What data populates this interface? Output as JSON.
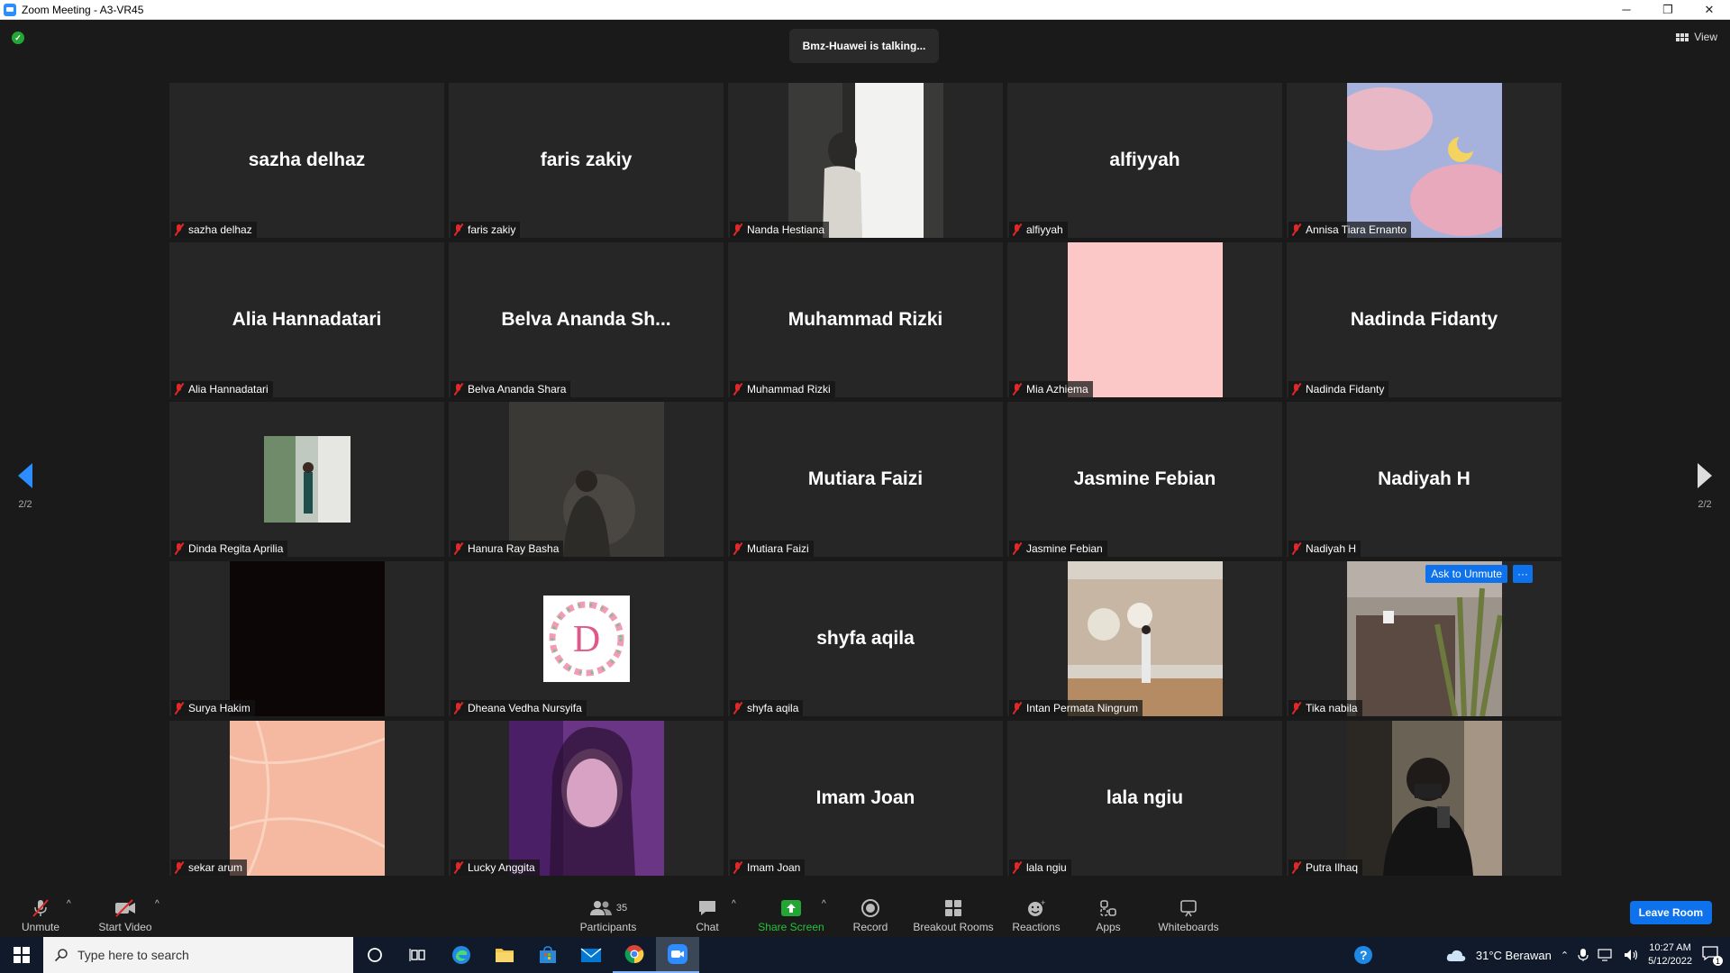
{
  "window": {
    "title": "Zoom Meeting - A3-VR45",
    "minimize": "─",
    "restore": "❐",
    "close": "✕"
  },
  "meeting": {
    "talking": "Bmz-Huawei is talking...",
    "view_label": "View",
    "page_left": "2/2",
    "page_right": "2/2",
    "ask_to_unmute": "Ask to Unmute",
    "more": "···"
  },
  "tiles": [
    {
      "big": "sazha delhaz",
      "label": "sazha delhaz"
    },
    {
      "big": "faris zakiy",
      "label": "faris zakiy"
    },
    {
      "big": "",
      "label": "Nanda Hestiana",
      "media": "window-photo"
    },
    {
      "big": "alfiyyah",
      "label": "alfiyyah"
    },
    {
      "big": "",
      "label": "Annisa Tiara Ernanto",
      "media": "moon-sky"
    },
    {
      "big": "Alia Hannadatari",
      "label": "Alia Hannadatari"
    },
    {
      "big": "Belva Ananda Sh...",
      "label": "Belva Ananda Shara"
    },
    {
      "big": "Muhammad Rizki",
      "label": "Muhammad Rizki"
    },
    {
      "big": "",
      "label": "Mia Azhiema",
      "media": "pink"
    },
    {
      "big": "Nadinda Fidanty",
      "label": "Nadinda Fidanty"
    },
    {
      "big": "",
      "label": "Dinda Regita Aprilia",
      "media": "garden-photo"
    },
    {
      "big": "",
      "label": "Hanura Ray Basha",
      "media": "dark-photo"
    },
    {
      "big": "Mutiara Faizi",
      "label": "Mutiara Faizi"
    },
    {
      "big": "Jasmine Febian",
      "label": "Jasmine Febian"
    },
    {
      "big": "Nadiyah H",
      "label": "Nadiyah H"
    },
    {
      "big": "",
      "label": "Surya Hakim",
      "media": "black"
    },
    {
      "big": "",
      "label": "Dheana Vedha Nursyifa",
      "media": "letter-d"
    },
    {
      "big": "shyfa aqila",
      "label": "shyfa aqila"
    },
    {
      "big": "",
      "label": "Intan Permata Ningrum",
      "media": "museum-photo"
    },
    {
      "big": "",
      "label": "Tika nabila",
      "media": "plant-photo"
    },
    {
      "big": "",
      "label": "sekar arum",
      "media": "peach"
    },
    {
      "big": "",
      "label": "Lucky Anggita",
      "media": "purple-selfie"
    },
    {
      "big": "Imam Joan",
      "label": "Imam Joan"
    },
    {
      "big": "lala ngiu",
      "label": "lala ngiu"
    },
    {
      "big": "",
      "label": "Putra Ilhaq",
      "media": "mirror-selfie"
    }
  ],
  "letter_d": "D",
  "toolbar": {
    "unmute": "Unmute",
    "start_video": "Start Video",
    "participants": "Participants",
    "participants_count": "35",
    "chat": "Chat",
    "share_screen": "Share Screen",
    "record": "Record",
    "breakout_rooms": "Breakout Rooms",
    "reactions": "Reactions",
    "apps": "Apps",
    "whiteboards": "Whiteboards",
    "leave_room": "Leave Room",
    "caret": "^"
  },
  "taskbar": {
    "search_placeholder": "Type here to search",
    "weather": "31°C  Berawan",
    "time": "10:27 AM",
    "date": "5/12/2022",
    "notifications": "1"
  },
  "colors": {
    "accent": "#0e72ed",
    "muted_red": "#e02828",
    "share_green": "#23a636"
  }
}
